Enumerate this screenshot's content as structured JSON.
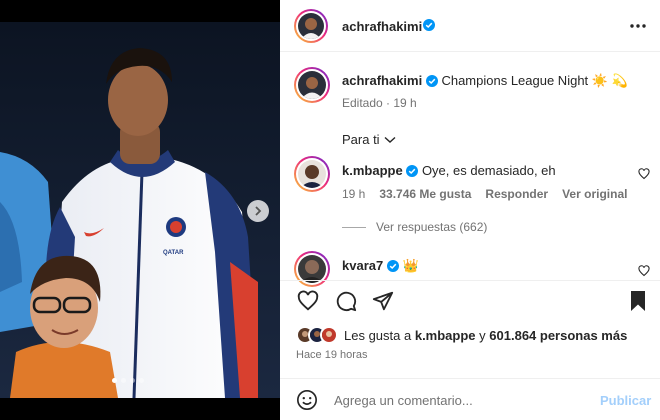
{
  "post": {
    "author": "achrafhakimi",
    "caption_author": "achrafhakimi",
    "caption": "Champions League Night",
    "caption_emojis": "☀️ 💫",
    "edited_label": "Editado",
    "edited_time": "19 h",
    "more_icon": "more-horizontal-icon",
    "carousel_dots": 4,
    "carousel_active": 0
  },
  "sort": {
    "label": "Para ti",
    "icon": "chevron-down-icon"
  },
  "comments": [
    {
      "user": "k.mbappe",
      "text": "Oye, es demasiado, eh",
      "time": "19 h",
      "likes": "33.746 Me gusta",
      "reply": "Responder",
      "translate": "Ver original"
    },
    {
      "user": "kvara7",
      "text": "👑"
    }
  ],
  "replies": {
    "label": "Ver respuestas (662)"
  },
  "likes": {
    "prefix": "Les gusta a",
    "user": "k.mbappe",
    "joiner": "y",
    "count": "601.864 personas más"
  },
  "ago": "Hace 19 horas",
  "composer": {
    "placeholder": "Agrega un comentario...",
    "submit": "Publicar",
    "emoji_icon": "emoji-icon"
  },
  "colors": {
    "verified": "#0095f6",
    "publish_disabled": "#a3cffb",
    "muted": "#737373"
  }
}
